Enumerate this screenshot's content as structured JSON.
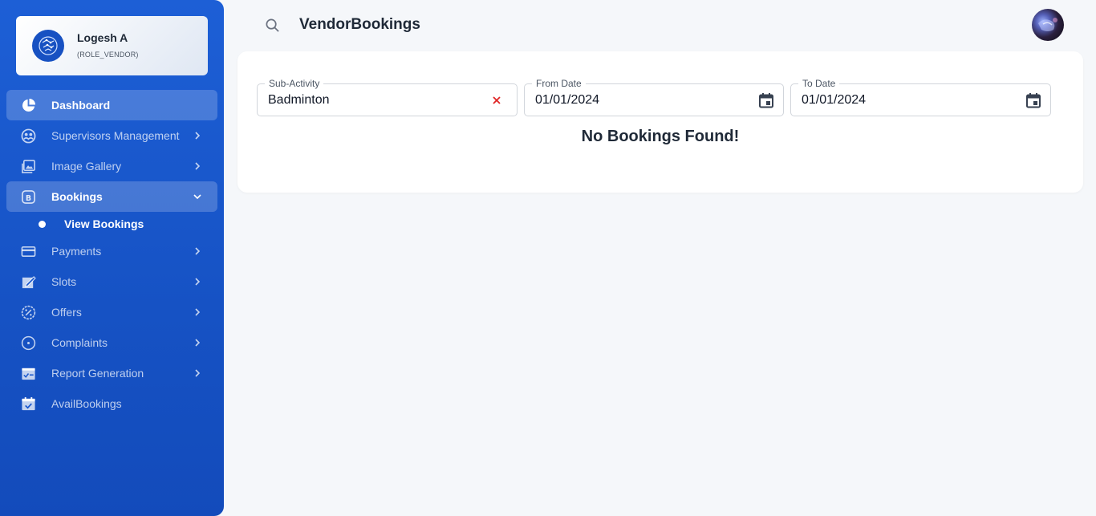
{
  "profile": {
    "name": "Logesh A",
    "role": "(ROLE_VENDOR)"
  },
  "nav": {
    "dashboard": "Dashboard",
    "supervisors": "Supervisors Management",
    "gallery": "Image Gallery",
    "bookings": "Bookings",
    "view_bookings": "View Bookings",
    "payments": "Payments",
    "slots": "Slots",
    "offers": "Offers",
    "complaints": "Complaints",
    "reports": "Report Generation",
    "avail": "AvailBookings"
  },
  "header": {
    "title": "VendorBookings"
  },
  "filters": {
    "sub_activity": {
      "label": "Sub-Activity",
      "value": "Badminton"
    },
    "from_date": {
      "label": "From Date",
      "value": "01/01/2024"
    },
    "to_date": {
      "label": "To Date",
      "value": "01/01/2024"
    }
  },
  "results": {
    "empty_message": "No Bookings Found!"
  },
  "colors": {
    "brand": "#1d5fd6",
    "clear": "#e02424"
  },
  "icons": [
    "logo-icon",
    "dashboard-icon",
    "supervisors-icon",
    "gallery-icon",
    "bookings-icon",
    "payments-icon",
    "slots-icon",
    "offers-icon",
    "complaints-icon",
    "report-icon",
    "avail-icon",
    "search-icon",
    "calendar-icon",
    "clear-icon",
    "chevron-right-icon",
    "chevron-down-icon"
  ]
}
